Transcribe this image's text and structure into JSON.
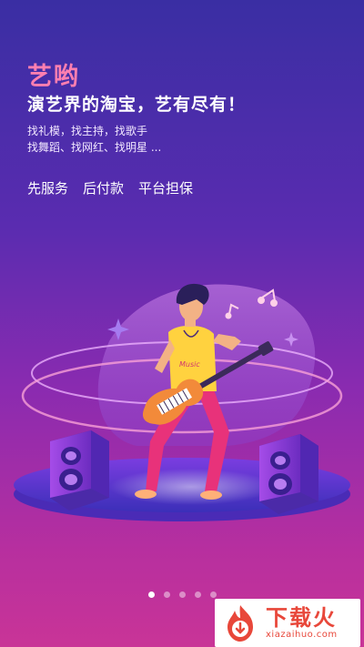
{
  "intro": {
    "brand": "艺哟",
    "headline": "演艺界的淘宝，艺有尽有！",
    "sub_line1": "找礼模，找主持，找歌手",
    "sub_line2": "找舞蹈、找网红、找明星 ...",
    "features": [
      "先服务",
      "后付款",
      "平台担保"
    ]
  },
  "illustration": {
    "shirt_text": "Music"
  },
  "pager": {
    "total": 5,
    "active_index": 0
  },
  "watermark": {
    "title": "下载火",
    "url": "xiazaihuo.com"
  },
  "colors": {
    "brand": "#ff7fb0",
    "background_top": "#3a2ea3",
    "background_bottom": "#c93497",
    "watermark_accent": "#e8473a"
  }
}
